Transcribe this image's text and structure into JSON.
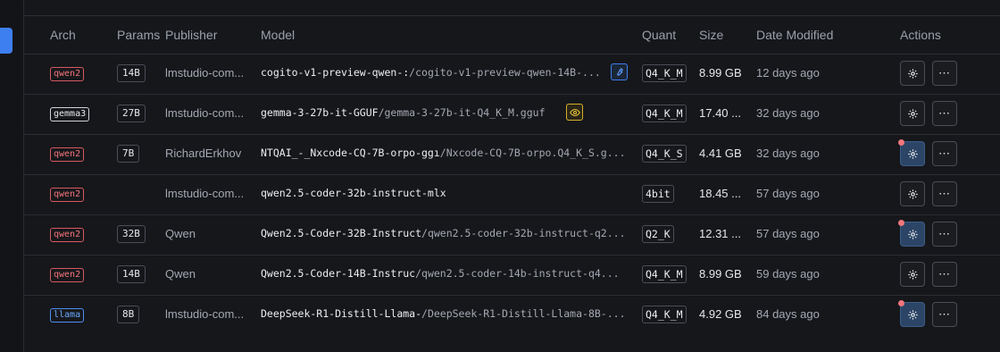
{
  "header": {
    "arch": "Arch",
    "params": "Params",
    "publisher": "Publisher",
    "model": "Model",
    "quant": "Quant",
    "size": "Size",
    "date": "Date Modified",
    "actions": "Actions"
  },
  "rows": [
    {
      "arch": "qwen2",
      "archColor": "#f2767c",
      "params": "14B",
      "publisher": "lmstudio-com...",
      "repo": "cogito-v1-preview-qwen-:",
      "file": "/cogito-v1-preview-qwen-14B-...",
      "badge": "tool-icon",
      "quant": "Q4_K_M",
      "size": "8.99 GB",
      "date": "12 days ago",
      "gearActive": false
    },
    {
      "arch": "gemma3",
      "archColor": "#e6e8ec",
      "params": "27B",
      "publisher": "lmstudio-com...",
      "repo": "gemma-3-27b-it-GGUF",
      "file": "/gemma-3-27b-it-Q4_K_M.gguf",
      "badge": "eye-icon",
      "quant": "Q4_K_M",
      "size": "17.40 ...",
      "date": "32 days ago",
      "gearActive": false
    },
    {
      "arch": "qwen2",
      "archColor": "#f2767c",
      "params": "7B",
      "publisher": "RichardErkhov",
      "repo": "NTQAI_-_Nxcode-CQ-7B-orpo-ggı",
      "file": "/Nxcode-CQ-7B-orpo.Q4_K_S.g...",
      "badge": "",
      "quant": "Q4_K_S",
      "size": "4.41 GB",
      "date": "32 days ago",
      "gearActive": true
    },
    {
      "arch": "qwen2",
      "archColor": "#f2767c",
      "params": "",
      "publisher": "lmstudio-com...",
      "repo": "qwen2.5-coder-32b-instruct-mlx",
      "file": "",
      "badge": "",
      "quant": "4bit",
      "size": "18.45 ...",
      "date": "57 days ago",
      "gearActive": false
    },
    {
      "arch": "qwen2",
      "archColor": "#f2767c",
      "params": "32B",
      "publisher": "Qwen",
      "repo": "Qwen2.5-Coder-32B-Instruct",
      "file": "/qwen2.5-coder-32b-instruct-q2...",
      "badge": "",
      "quant": "Q2_K",
      "size": "12.31 ...",
      "date": "57 days ago",
      "gearActive": true
    },
    {
      "arch": "qwen2",
      "archColor": "#f2767c",
      "params": "14B",
      "publisher": "Qwen",
      "repo": "Qwen2.5-Coder-14B-Instruc",
      "file": "/qwen2.5-coder-14b-instruct-q4...",
      "badge": "",
      "quant": "Q4_K_M",
      "size": "8.99 GB",
      "date": "59 days ago",
      "gearActive": false
    },
    {
      "arch": "llama",
      "archColor": "#6aa9ff",
      "params": "8B",
      "publisher": "lmstudio-com...",
      "repo": "DeepSeek-R1-Distill-Llama-",
      "file": "/DeepSeek-R1-Distill-Llama-8B-...",
      "badge": "",
      "quant": "Q4_K_M",
      "size": "4.92 GB",
      "date": "84 days ago",
      "gearActive": true
    }
  ],
  "icons": {
    "gear": "gear-icon",
    "more": "more-horizontal-icon"
  }
}
